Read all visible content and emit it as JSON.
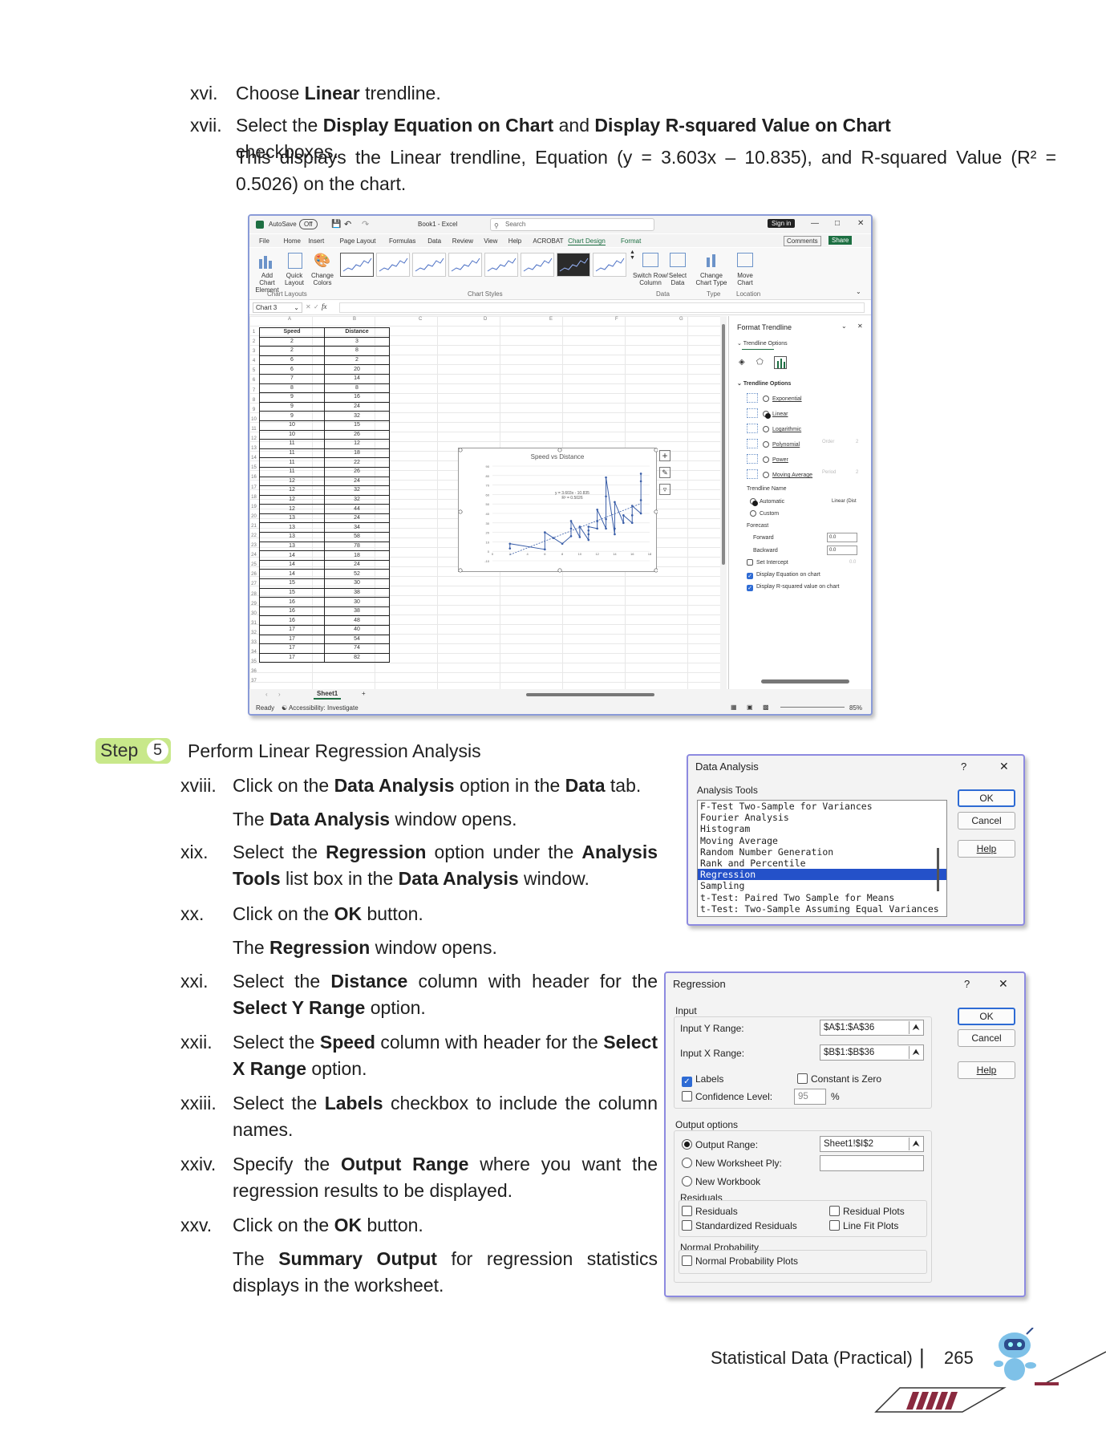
{
  "steps_top": [
    {
      "num": "xvi.",
      "html": "Choose <b>Linear</b> trendline."
    },
    {
      "num": "xvii.",
      "html": "Select the <b>Display Equation on Chart</b> and <b>Display R-squared Value on Chart</b> checkboxes."
    },
    {
      "num": "",
      "html": "This displays the Linear trendline, Equation (y = 3.603x – 10.835), and R-squared Value (R² = 0.5026) on the chart."
    }
  ],
  "excel": {
    "autosave": "AutoSave",
    "autosave_state": "Off",
    "file_title": "Book1 - Excel",
    "search_placeholder": "Search",
    "sign_in": "Sign in",
    "menu": [
      "File",
      "Home",
      "Insert",
      "Page Layout",
      "Formulas",
      "Data",
      "Review",
      "View",
      "Help",
      "ACROBAT",
      "Chart Design",
      "Format"
    ],
    "comments": "Comments",
    "share": "Share",
    "ribbon_groups": [
      "Chart Layouts",
      "Chart Styles",
      "Data",
      "Type",
      "Location"
    ],
    "ribbon_buttons": [
      "Add Chart Element",
      "Quick Layout",
      "Change Colors",
      "Switch Row/ Column",
      "Select Data",
      "Change Chart Type",
      "Move Chart"
    ],
    "name_box": "Chart 3",
    "columns": [
      "A",
      "B",
      "C",
      "D",
      "E",
      "F",
      "G"
    ],
    "table_headers": [
      "Speed",
      "Distance"
    ],
    "rows": [
      [
        2,
        3
      ],
      [
        2,
        8
      ],
      [
        6,
        2
      ],
      [
        6,
        20
      ],
      [
        7,
        14
      ],
      [
        8,
        8
      ],
      [
        9,
        16
      ],
      [
        9,
        24
      ],
      [
        9,
        32
      ],
      [
        10,
        15
      ],
      [
        10,
        26
      ],
      [
        11,
        12
      ],
      [
        11,
        18
      ],
      [
        11,
        22
      ],
      [
        11,
        26
      ],
      [
        12,
        24
      ],
      [
        12,
        32
      ],
      [
        12,
        32
      ],
      [
        12,
        44
      ],
      [
        13,
        24
      ],
      [
        13,
        34
      ],
      [
        13,
        58
      ],
      [
        13,
        78
      ],
      [
        14,
        18
      ],
      [
        14,
        24
      ],
      [
        14,
        52
      ],
      [
        15,
        30
      ],
      [
        15,
        38
      ],
      [
        16,
        30
      ],
      [
        16,
        38
      ],
      [
        16,
        48
      ],
      [
        17,
        40
      ],
      [
        17,
        54
      ],
      [
        17,
        74
      ],
      [
        17,
        82
      ]
    ],
    "chart": {
      "title": "Speed vs Distance",
      "equation": "y = 3.603x - 10.835",
      "r2": "R² = 0.5026"
    },
    "format_pane": {
      "title": "Format Trendline",
      "section": "Trendline Options",
      "subsection": "Trendline Options",
      "options": [
        "Exponential",
        "Linear",
        "Logarithmic",
        "Polynomial",
        "Power",
        "Moving Average"
      ],
      "selected": "Linear",
      "order_label": "Order",
      "order_value": "2",
      "period_label": "Period",
      "period_value": "2",
      "trendline_name": "Trendline Name",
      "automatic": "Automatic",
      "automatic_value": "Linear (Dist",
      "custom": "Custom",
      "forecast": "Forecast",
      "forward": "Forward",
      "forward_value": "0.0",
      "backward": "Backward",
      "backward_value": "0.0",
      "set_intercept": "Set Intercept",
      "intercept_value": "0.0",
      "display_equation": "Display Equation on chart",
      "display_r2": "Display R-squared value on chart"
    },
    "sheet_tab": "Sheet1",
    "status_ready": "Ready",
    "accessibility": "Accessibility: Investigate",
    "zoom": "85%"
  },
  "step5": {
    "word": "Step",
    "num": "5",
    "title": "Perform Linear Regression Analysis"
  },
  "steps_bottom": [
    {
      "num": "xviii.",
      "html": "Click on the <b>Data Analysis</b> option in the <b>Data</b> tab."
    },
    {
      "num": "",
      "html": "The <b>Data Analysis</b> window opens."
    },
    {
      "num": "xix.",
      "html": "Select the <b>Regression</b> option under the <b>Analysis Tools</b> list box in the <b>Data Analysis</b> window."
    },
    {
      "num": "xx.",
      "html": "Click on the <b>OK</b> button."
    },
    {
      "num": "",
      "html": "The <b>Regression</b> window opens."
    },
    {
      "num": "xxi.",
      "html": "Select the <b>Distance</b> column with header for the <b>Select Y Range</b> option."
    },
    {
      "num": "xxii.",
      "html": "Select the <b>Speed</b> column with header for the <b>Select X Range</b> option."
    },
    {
      "num": "xxiii.",
      "html": "Select the <b>Labels</b> checkbox to include the column names."
    },
    {
      "num": "xxiv.",
      "html": "Specify the <b>Output Range</b> where you want the regression results to be displayed."
    },
    {
      "num": "xxv.",
      "html": "Click on the <b>OK</b> button."
    },
    {
      "num": "",
      "html": "The <b>Summary Output</b> for regression statistics displays in the worksheet."
    }
  ],
  "data_analysis": {
    "title": "Data Analysis",
    "help_glyph": "?",
    "close_glyph": "✕",
    "list_label": "Analysis Tools",
    "items": [
      "F-Test Two-Sample for Variances",
      "Fourier Analysis",
      "Histogram",
      "Moving Average",
      "Random Number Generation",
      "Rank and Percentile",
      "Regression",
      "Sampling",
      "t-Test: Paired Two Sample for Means",
      "t-Test: Two-Sample Assuming Equal Variances"
    ],
    "selected": "Regression",
    "ok": "OK",
    "cancel": "Cancel",
    "help": "Help"
  },
  "regression": {
    "title": "Regression",
    "help_glyph": "?",
    "close_glyph": "✕",
    "input_label": "Input",
    "y_range_label": "Input Y Range:",
    "y_range_value": "$A$1:$A$36",
    "x_range_label": "Input X Range:",
    "x_range_value": "$B$1:$B$36",
    "labels": "Labels",
    "constant_zero": "Constant is Zero",
    "confidence": "Confidence Level:",
    "confidence_value": "95",
    "percent": "%",
    "output_options": "Output options",
    "output_range": "Output Range:",
    "output_range_value": "Sheet1!$I$2",
    "new_ply": "New Worksheet Ply:",
    "new_workbook": "New Workbook",
    "residuals_group": "Residuals",
    "residuals": "Residuals",
    "std_residuals": "Standardized Residuals",
    "residual_plots": "Residual Plots",
    "line_fit": "Line Fit Plots",
    "normal_prob_group": "Normal Probability",
    "normal_prob": "Normal Probability Plots",
    "ok": "OK",
    "cancel": "Cancel",
    "help": "Help"
  },
  "footer": {
    "title": "Statistical Data (Practical)",
    "separator": "|",
    "page": "265"
  },
  "colors": {
    "step_badge": "#c8e88a",
    "dialog_border": "#8d8ae0",
    "selection_blue": "#2451c9",
    "accent_maroon": "#8a2a3f"
  }
}
